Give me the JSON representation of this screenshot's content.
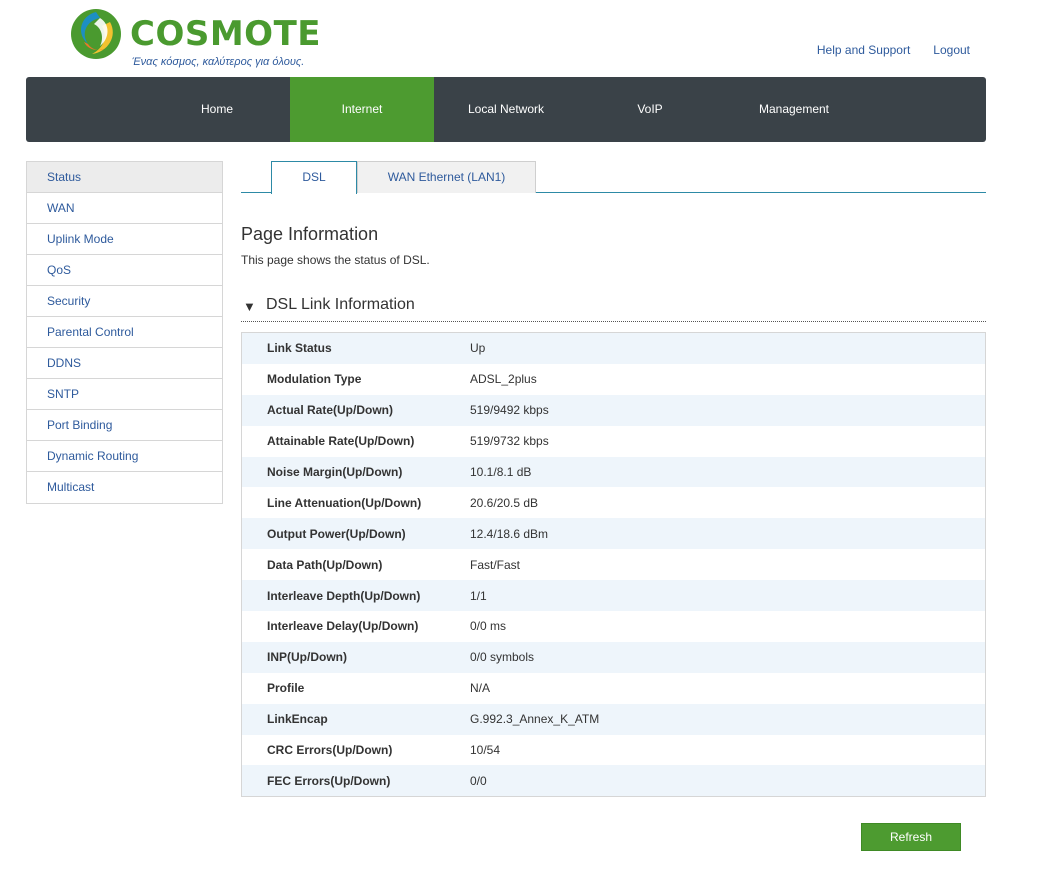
{
  "header": {
    "brand": "COSMOTE",
    "tagline": "Ένας κόσμος, καλύτερος για όλους.",
    "logo_icon": "cosmote-swirl-logo",
    "links": [
      "Help and Support",
      "Logout"
    ]
  },
  "nav": {
    "items": [
      "Home",
      "Internet",
      "Local Network",
      "VoIP",
      "Management"
    ],
    "active": "Internet"
  },
  "sidebar": {
    "items": [
      "Status",
      "WAN",
      "Uplink Mode",
      "QoS",
      "Security",
      "Parental Control",
      "DDNS",
      "SNTP",
      "Port Binding",
      "Dynamic Routing",
      "Multicast"
    ],
    "active": "Status"
  },
  "tabs": {
    "items": [
      "DSL",
      "WAN Ethernet (LAN1)"
    ],
    "active": "DSL"
  },
  "page": {
    "title": "Page Information",
    "description": "This page shows the status of DSL."
  },
  "section": {
    "title": "DSL Link Information",
    "rows": [
      {
        "label": "Link Status",
        "value": "Up"
      },
      {
        "label": "Modulation Type",
        "value": "ADSL_2plus"
      },
      {
        "label": "Actual Rate(Up/Down)",
        "value": "519/9492 kbps"
      },
      {
        "label": "Attainable Rate(Up/Down)",
        "value": "519/9732 kbps"
      },
      {
        "label": "Noise Margin(Up/Down)",
        "value": "10.1/8.1 dB"
      },
      {
        "label": "Line Attenuation(Up/Down)",
        "value": "20.6/20.5 dB"
      },
      {
        "label": "Output Power(Up/Down)",
        "value": "12.4/18.6 dBm"
      },
      {
        "label": "Data Path(Up/Down)",
        "value": "Fast/Fast"
      },
      {
        "label": "Interleave Depth(Up/Down)",
        "value": "1/1"
      },
      {
        "label": "Interleave Delay(Up/Down)",
        "value": "0/0 ms"
      },
      {
        "label": "INP(Up/Down)",
        "value": "0/0 symbols"
      },
      {
        "label": "Profile",
        "value": "N/A"
      },
      {
        "label": "LinkEncap",
        "value": "G.992.3_Annex_K_ATM"
      },
      {
        "label": "CRC Errors(Up/Down)",
        "value": "10/54"
      },
      {
        "label": "FEC Errors(Up/Down)",
        "value": "0/0"
      }
    ]
  },
  "actions": {
    "refresh_label": "Refresh"
  },
  "colors": {
    "accent_green": "#4d9b30",
    "nav_bg": "#3a4248",
    "link_blue": "#2e5a9c",
    "row_alt": "#eef5fb"
  }
}
